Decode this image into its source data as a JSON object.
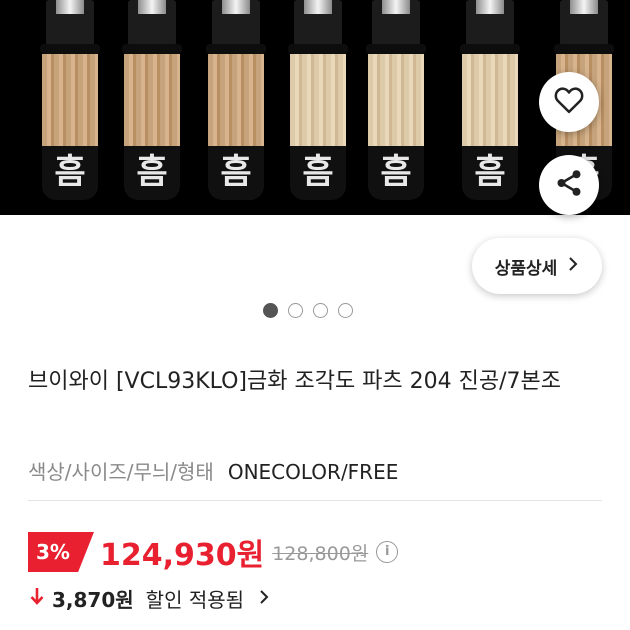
{
  "hero": {
    "glyph": "흠"
  },
  "actions": {
    "like_icon": "heart-icon",
    "share_icon": "share-icon"
  },
  "detail_button": {
    "label": "상품상세",
    "icon": "chevron-right-icon"
  },
  "carousel": {
    "total": 4,
    "active_index": 0
  },
  "product": {
    "title": "브이와이 [VCL93KLO]금화 조각도 파츠 204 진공/7본조",
    "option_label": "색상/사이즈/무늬/형태",
    "option_value": "ONECOLOR/FREE"
  },
  "pricing": {
    "discount_rate": "3%",
    "sale_price": "124,930원",
    "original_price": "128,800원",
    "info_icon": "info-icon",
    "discount_amount": "3,870원",
    "discount_text": "할인 적용됨",
    "arrow_icon": "down-arrow-icon",
    "chevron_icon": "chevron-right-icon"
  },
  "colors": {
    "accent": "#e8202f",
    "text": "#222222",
    "muted": "#8a8a8a"
  }
}
